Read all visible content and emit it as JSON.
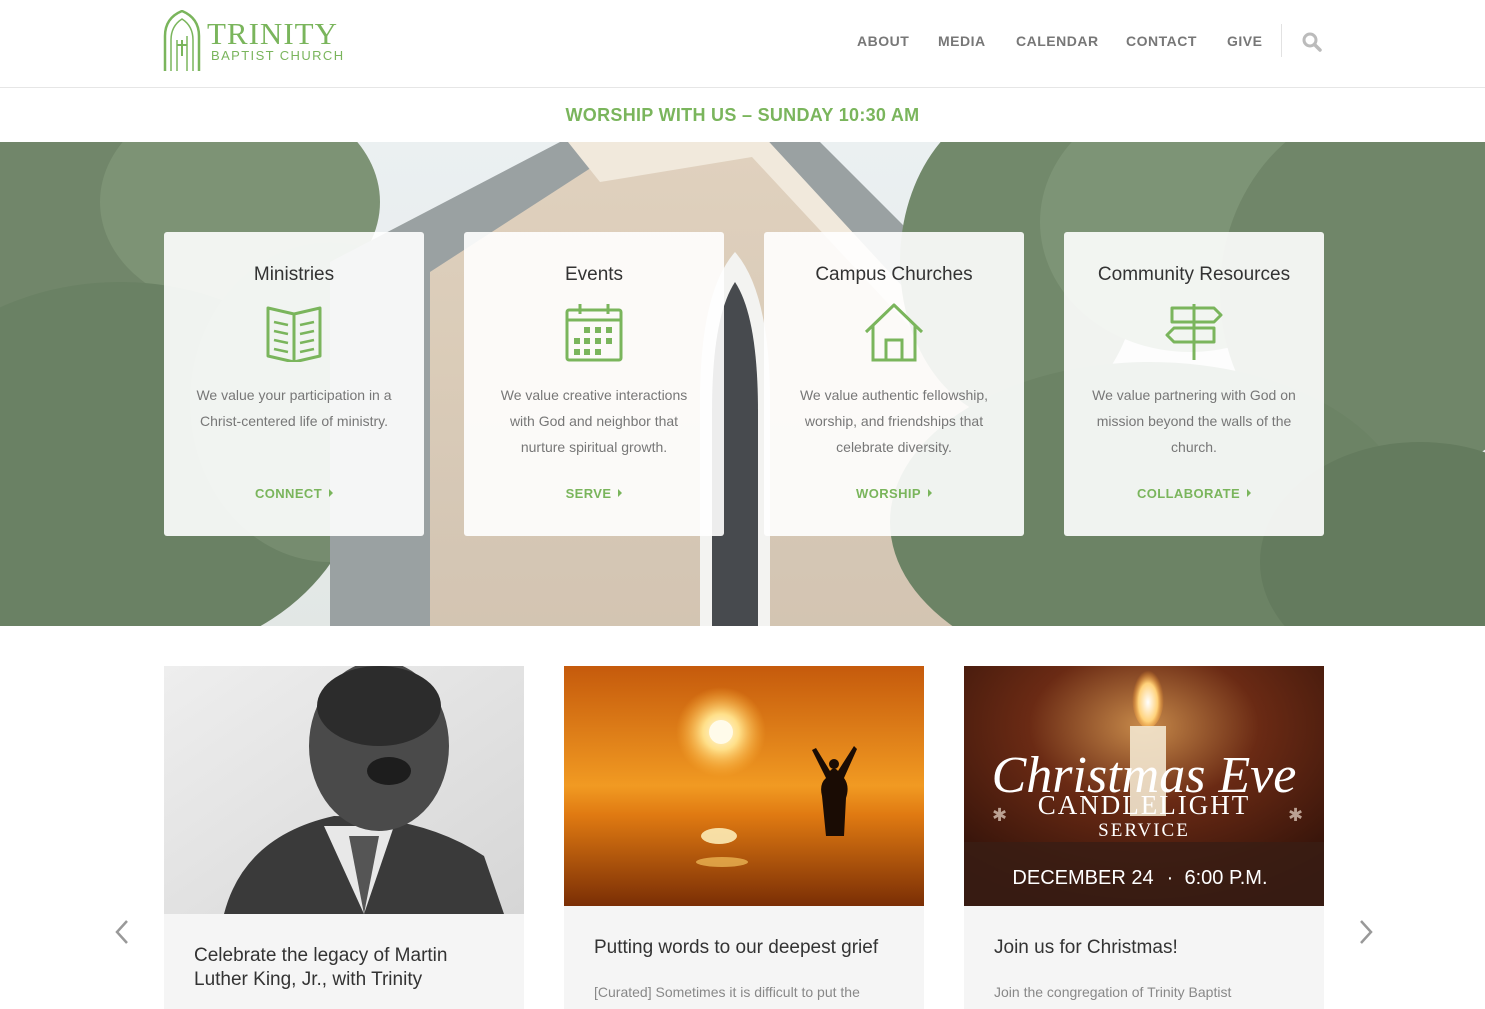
{
  "logo": {
    "title": "TRINITY",
    "subtitle": "BAPTIST CHURCH"
  },
  "nav": {
    "items": [
      "ABOUT",
      "MEDIA",
      "CALENDAR",
      "CONTACT",
      "GIVE"
    ],
    "search_icon": "search-icon"
  },
  "worship_banner": "WORSHIP WITH US – SUNDAY 10:30 AM",
  "cards": [
    {
      "title": "Ministries",
      "icon": "book-icon",
      "desc": "We value your participation in a Christ-centered life of ministry.",
      "link": "CONNECT"
    },
    {
      "title": "Events",
      "icon": "calendar-icon",
      "desc": "We value creative interactions with God and neighbor that nurture spiritual growth.",
      "link": "SERVE"
    },
    {
      "title": "Campus Churches",
      "icon": "house-icon",
      "desc": "We value authentic fellowship, worship, and friendships that celebrate diversity.",
      "link": "WORSHIP"
    },
    {
      "title": "Community Resources",
      "icon": "signpost-icon",
      "desc": "We value partnering with God on mission beyond the walls of the church.",
      "link": "COLLABORATE"
    }
  ],
  "posts": [
    {
      "title": "Celebrate the legacy of Martin Luther King, Jr., with Trinity",
      "excerpt": ""
    },
    {
      "title": "Putting words to our deepest grief",
      "excerpt": "[Curated] Sometimes it is difficult to put the"
    },
    {
      "title": "Join us for Christmas!",
      "excerpt": "Join the congregation of Trinity Baptist",
      "image_text": {
        "script": "Christmas Eve",
        "line1": "CANDLELIGHT",
        "line2": "SERVICE",
        "date": "DECEMBER 24",
        "time": "6:00 P.M."
      }
    }
  ],
  "colors": {
    "accent": "#7ab55c",
    "nav_text": "#777777"
  }
}
